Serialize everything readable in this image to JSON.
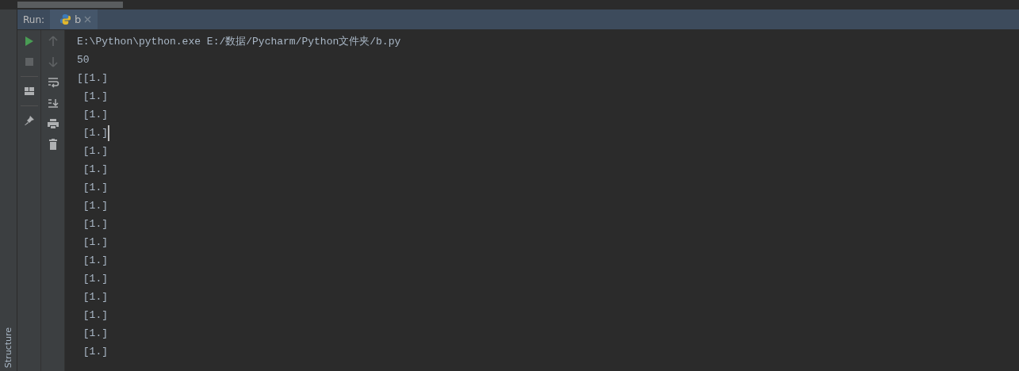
{
  "side_panel": {
    "label": "Structure"
  },
  "run_header": {
    "title": "Run:",
    "tabs": [
      {
        "label": "b",
        "selected": true
      }
    ]
  },
  "toolbar_left": [
    {
      "kind": "run"
    },
    {
      "kind": "stop",
      "disabled": true
    },
    {
      "kind": "layout"
    },
    {
      "kind": "pin"
    }
  ],
  "toolbar_right": [
    {
      "kind": "up",
      "disabled": true
    },
    {
      "kind": "down",
      "disabled": true
    },
    {
      "kind": "wrap"
    },
    {
      "kind": "scroll-end"
    },
    {
      "kind": "print"
    },
    {
      "kind": "trash"
    }
  ],
  "console": {
    "lines": [
      {
        "text": "E:\\Python\\python.exe E:/数据/Pycharm/Python文件夹/b.py",
        "caret": false
      },
      {
        "text": "50",
        "caret": false
      },
      {
        "text": "[[1.]",
        "caret": false
      },
      {
        "text": " [1.]",
        "caret": false
      },
      {
        "text": " [1.]",
        "caret": false
      },
      {
        "text": " [1.]",
        "caret": true
      },
      {
        "text": " [1.]",
        "caret": false
      },
      {
        "text": " [1.]",
        "caret": false
      },
      {
        "text": " [1.]",
        "caret": false
      },
      {
        "text": " [1.]",
        "caret": false
      },
      {
        "text": " [1.]",
        "caret": false
      },
      {
        "text": " [1.]",
        "caret": false
      },
      {
        "text": " [1.]",
        "caret": false
      },
      {
        "text": " [1.]",
        "caret": false
      },
      {
        "text": " [1.]",
        "caret": false
      },
      {
        "text": " [1.]",
        "caret": false
      },
      {
        "text": " [1.]",
        "caret": false
      },
      {
        "text": " [1.]",
        "caret": false
      }
    ]
  }
}
